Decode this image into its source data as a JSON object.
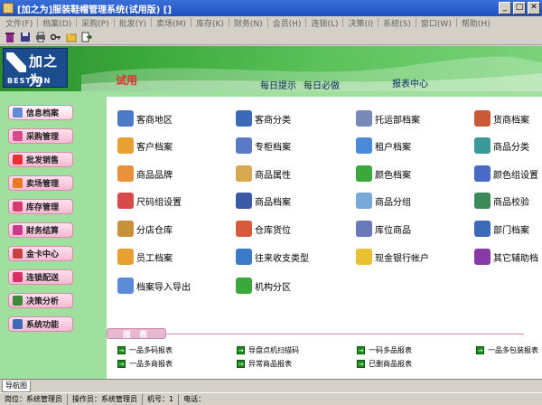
{
  "window": {
    "title": "[加之为]服装鞋帽管理系统(试用版) []",
    "min": "_",
    "max": "□",
    "close": "✕"
  },
  "menu": [
    "文件(F)",
    "档案(D)",
    "采购(P)",
    "批发(Y)",
    "卖场(M)",
    "库存(K)",
    "财务(N)",
    "会员(H)",
    "连锁(L)",
    "决策(I)",
    "系统(S)",
    "窗口(W)",
    "帮助(H)"
  ],
  "toolbar": [
    "trash-icon",
    "save-icon",
    "print-icon",
    "key-icon",
    "folder-icon",
    "exit-icon"
  ],
  "banner": {
    "logo_cn": "加之为",
    "logo_en": "BESTWIN",
    "trial": "试用",
    "daily_tip": "每日提示",
    "daily_must": "每日必做",
    "report_center": "报表中心"
  },
  "nav": [
    {
      "label": "信息档案",
      "color": "#5a8fd8"
    },
    {
      "label": "采购管理",
      "color": "#d84a8a"
    },
    {
      "label": "批发销售",
      "color": "#e83030"
    },
    {
      "label": "卖场管理",
      "color": "#e87a20"
    },
    {
      "label": "库存管理",
      "color": "#d83a6a"
    },
    {
      "label": "财务结算",
      "color": "#c83a8a"
    },
    {
      "label": "金卡中心",
      "color": "#c84040"
    },
    {
      "label": "连锁配送",
      "color": "#d83060"
    },
    {
      "label": "决策分析",
      "color": "#3a8a3a"
    },
    {
      "label": "系统功能",
      "color": "#3a6ab8"
    }
  ],
  "items": [
    {
      "label": "客商地区",
      "color": "#4a7ac8"
    },
    {
      "label": "客商分类",
      "color": "#3a6ab8"
    },
    {
      "label": "托运部档案",
      "color": "#7a8ab8"
    },
    {
      "label": "货商档案",
      "color": "#c85a3a"
    },
    {
      "label": "客户档案",
      "color": "#e8a030"
    },
    {
      "label": "专柜档案",
      "color": "#5a7ac8"
    },
    {
      "label": "租户档案",
      "color": "#4a8ad8"
    },
    {
      "label": "商品分类",
      "color": "#3a9a9a"
    },
    {
      "label": "商品品牌",
      "color": "#e8903a"
    },
    {
      "label": "商品属性",
      "color": "#d8a850"
    },
    {
      "label": "颜色档案",
      "color": "#3aa83a"
    },
    {
      "label": "颜色组设置",
      "color": "#4a6ac8"
    },
    {
      "label": "尺码组设置",
      "color": "#d84a4a"
    },
    {
      "label": "商品档案",
      "color": "#3a5aa8"
    },
    {
      "label": "商品分组",
      "color": "#7aa8d8"
    },
    {
      "label": "商品校验",
      "color": "#3a8a5a"
    },
    {
      "label": "分店仓库",
      "color": "#c8903a"
    },
    {
      "label": "仓库货位",
      "color": "#d85a3a"
    },
    {
      "label": "库位商品",
      "color": "#6a7ab8"
    },
    {
      "label": "部门档案",
      "color": "#3a6ab8"
    },
    {
      "label": "员工档案",
      "color": "#e8a030"
    },
    {
      "label": "往来收支类型",
      "color": "#3a7ac8"
    },
    {
      "label": "现金银行帐户",
      "color": "#e8c030"
    },
    {
      "label": "其它辅助档",
      "color": "#8a3aa8"
    },
    {
      "label": "档案导入导出",
      "color": "#5a8ad8"
    },
    {
      "label": "机构分区",
      "color": "#3aa83a"
    }
  ],
  "report": {
    "tab": "报 表",
    "links": [
      "一品多码报表",
      "导盘点机扫描码",
      "一码多品报表",
      "一品多包装报表",
      "一品多商报表",
      "异常商品报表",
      "已删商品报表"
    ]
  },
  "navtab": "导航图",
  "status": [
    "岗位：系统管理员",
    "操作员：系统管理员",
    "机号：1",
    "电话："
  ]
}
